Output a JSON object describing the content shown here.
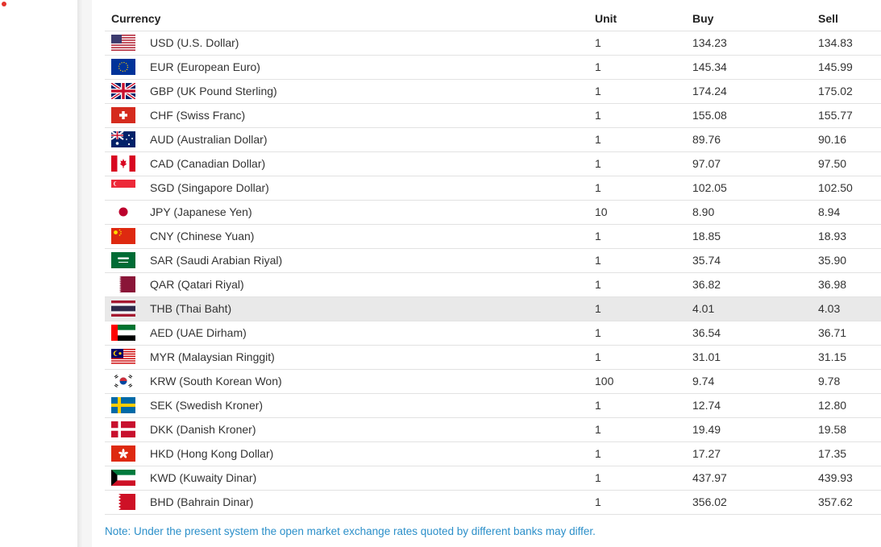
{
  "table": {
    "headers": {
      "currency": "Currency",
      "unit": "Unit",
      "buy": "Buy",
      "sell": "Sell"
    },
    "rows": [
      {
        "flag": "us-flag-icon",
        "currency": "USD (U.S. Dollar)",
        "unit": "1",
        "buy": "134.23",
        "sell": "134.83"
      },
      {
        "flag": "eu-flag-icon",
        "currency": "EUR (European Euro)",
        "unit": "1",
        "buy": "145.34",
        "sell": "145.99"
      },
      {
        "flag": "gb-flag-icon",
        "currency": "GBP (UK Pound Sterling)",
        "unit": "1",
        "buy": "174.24",
        "sell": "175.02"
      },
      {
        "flag": "ch-flag-icon",
        "currency": "CHF (Swiss Franc)",
        "unit": "1",
        "buy": "155.08",
        "sell": "155.77"
      },
      {
        "flag": "au-flag-icon",
        "currency": "AUD (Australian Dollar)",
        "unit": "1",
        "buy": "89.76",
        "sell": "90.16"
      },
      {
        "flag": "ca-flag-icon",
        "currency": "CAD (Canadian Dollar)",
        "unit": "1",
        "buy": "97.07",
        "sell": "97.50"
      },
      {
        "flag": "sg-flag-icon",
        "currency": "SGD (Singapore Dollar)",
        "unit": "1",
        "buy": "102.05",
        "sell": "102.50"
      },
      {
        "flag": "jp-flag-icon",
        "currency": "JPY (Japanese Yen)",
        "unit": "10",
        "buy": "8.90",
        "sell": "8.94"
      },
      {
        "flag": "cn-flag-icon",
        "currency": "CNY (Chinese Yuan)",
        "unit": "1",
        "buy": "18.85",
        "sell": "18.93"
      },
      {
        "flag": "sa-flag-icon",
        "currency": "SAR (Saudi Arabian Riyal)",
        "unit": "1",
        "buy": "35.74",
        "sell": "35.90"
      },
      {
        "flag": "qa-flag-icon",
        "currency": "QAR (Qatari Riyal)",
        "unit": "1",
        "buy": "36.82",
        "sell": "36.98"
      },
      {
        "flag": "th-flag-icon",
        "currency": "THB (Thai Baht)",
        "unit": "1",
        "buy": "4.01",
        "sell": "4.03",
        "highlighted": true
      },
      {
        "flag": "ae-flag-icon",
        "currency": "AED (UAE Dirham)",
        "unit": "1",
        "buy": "36.54",
        "sell": "36.71"
      },
      {
        "flag": "my-flag-icon",
        "currency": "MYR (Malaysian Ringgit)",
        "unit": "1",
        "buy": "31.01",
        "sell": "31.15"
      },
      {
        "flag": "kr-flag-icon",
        "currency": "KRW (South Korean Won)",
        "unit": "100",
        "buy": "9.74",
        "sell": "9.78"
      },
      {
        "flag": "se-flag-icon",
        "currency": "SEK (Swedish Kroner)",
        "unit": "1",
        "buy": "12.74",
        "sell": "12.80"
      },
      {
        "flag": "dk-flag-icon",
        "currency": "DKK (Danish Kroner)",
        "unit": "1",
        "buy": "19.49",
        "sell": "19.58"
      },
      {
        "flag": "hk-flag-icon",
        "currency": "HKD (Hong Kong Dollar)",
        "unit": "1",
        "buy": "17.27",
        "sell": "17.35"
      },
      {
        "flag": "kw-flag-icon",
        "currency": "KWD (Kuwaity Dinar)",
        "unit": "1",
        "buy": "437.97",
        "sell": "439.93"
      },
      {
        "flag": "bh-flag-icon",
        "currency": "BHD (Bahrain Dinar)",
        "unit": "1",
        "buy": "356.02",
        "sell": "357.62"
      }
    ]
  },
  "note": "Note: Under the present system the open market exchange rates quoted by different banks may differ.",
  "colors": {
    "note": "#2b8fc9",
    "highlight_row": "#e9e9e9",
    "divider": "#e2e2e2"
  }
}
